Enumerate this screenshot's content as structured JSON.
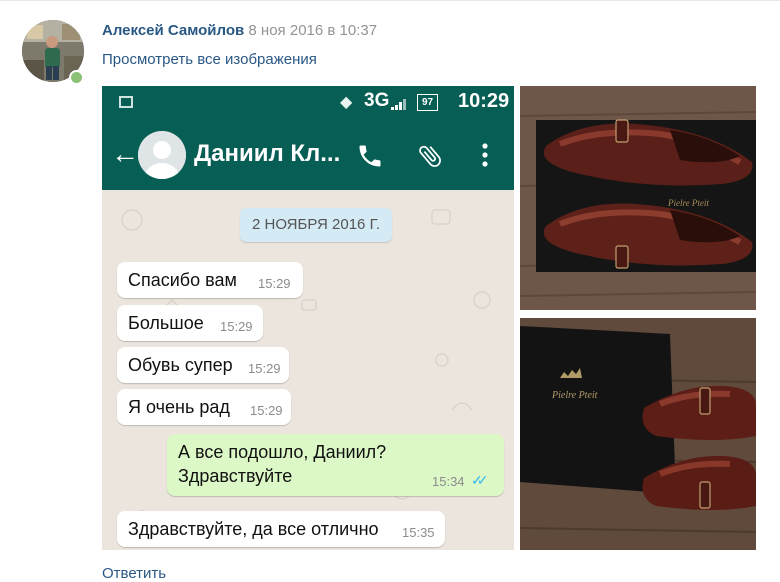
{
  "post": {
    "author_name": "Алексей Самойлов",
    "date": "8 ноя 2016 в 10:37",
    "view_all_label": "Просмотреть все изображения",
    "reply_label": "Ответить"
  },
  "phone_screenshot": {
    "status_bar": {
      "network": "3G",
      "battery": "97",
      "time": "10:29"
    },
    "app_bar": {
      "contact_name": "Даниил Кл..."
    },
    "date_divider": "2 НОЯБРЯ 2016 Г.",
    "messages": [
      {
        "text": "Спасибо вам",
        "time": "15:29",
        "direction": "in"
      },
      {
        "text": "Большое",
        "time": "15:29",
        "direction": "in"
      },
      {
        "text": "Обувь супер",
        "time": "15:29",
        "direction": "in"
      },
      {
        "text": "Я очень рад",
        "time": "15:29",
        "direction": "in"
      },
      {
        "text_line1": "А все подошло, Даниил?",
        "text_line2": "Здравствуйте",
        "time": "15:34",
        "direction": "out",
        "read": true
      },
      {
        "text": "Здравствуйте, да все отлично",
        "time": "15:35",
        "direction": "in"
      }
    ]
  },
  "photos": [
    {
      "icon": "shoes-on-box-photo"
    },
    {
      "icon": "shoes-and-box-photo"
    }
  ],
  "colors": {
    "link": "#2a5885",
    "whatsapp_header": "#075e54",
    "outgoing_bubble": "#dcf8c6",
    "read_ticks": "#34b7f1",
    "online_dot": "#8ac176"
  }
}
